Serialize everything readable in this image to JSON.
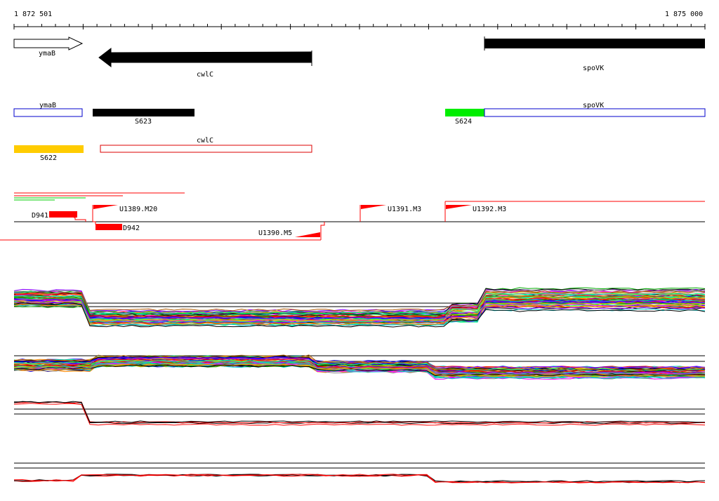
{
  "ruler": {
    "start_label": "1 872 501",
    "end_label": "1 875 000"
  },
  "genes": [
    {
      "name": "ymaB",
      "strand": "+",
      "style": "outline"
    },
    {
      "name": "cwlC",
      "strand": "-",
      "style": "filled"
    },
    {
      "name": "spoVK",
      "strand": "-",
      "style": "filled"
    }
  ],
  "features": [
    {
      "label": "ymaB",
      "kind": "gene-box",
      "color": "#0000cc"
    },
    {
      "label": "S623",
      "kind": "segment",
      "color": "#000000"
    },
    {
      "label": "S624",
      "kind": "segment",
      "color": "#00ee00"
    },
    {
      "label": "spoVK",
      "kind": "gene-box",
      "color": "#0000cc"
    },
    {
      "label": "S622",
      "kind": "segment",
      "color": "#ffcc00"
    },
    {
      "label": "cwlC",
      "kind": "gene-box",
      "color": "#dd0000"
    }
  ],
  "transcription_units": [
    {
      "label": "D941",
      "kind": "down"
    },
    {
      "label": "U1389.M20",
      "kind": "up"
    },
    {
      "label": "D942",
      "kind": "down"
    },
    {
      "label": "U1390.M5",
      "kind": "up"
    },
    {
      "label": "U1391.M3",
      "kind": "up"
    },
    {
      "label": "U1392.M3",
      "kind": "up"
    }
  ],
  "colors": {
    "ruler": "#000000",
    "up_shift": "#ff0000",
    "track_palette": [
      "#ff0000",
      "#00aa00",
      "#0000ff",
      "#ff00ff",
      "#00cccc",
      "#cccc00",
      "#ff8800",
      "#8800ff",
      "#000000",
      "#888888",
      "#00ff88",
      "#aa5500"
    ]
  }
}
